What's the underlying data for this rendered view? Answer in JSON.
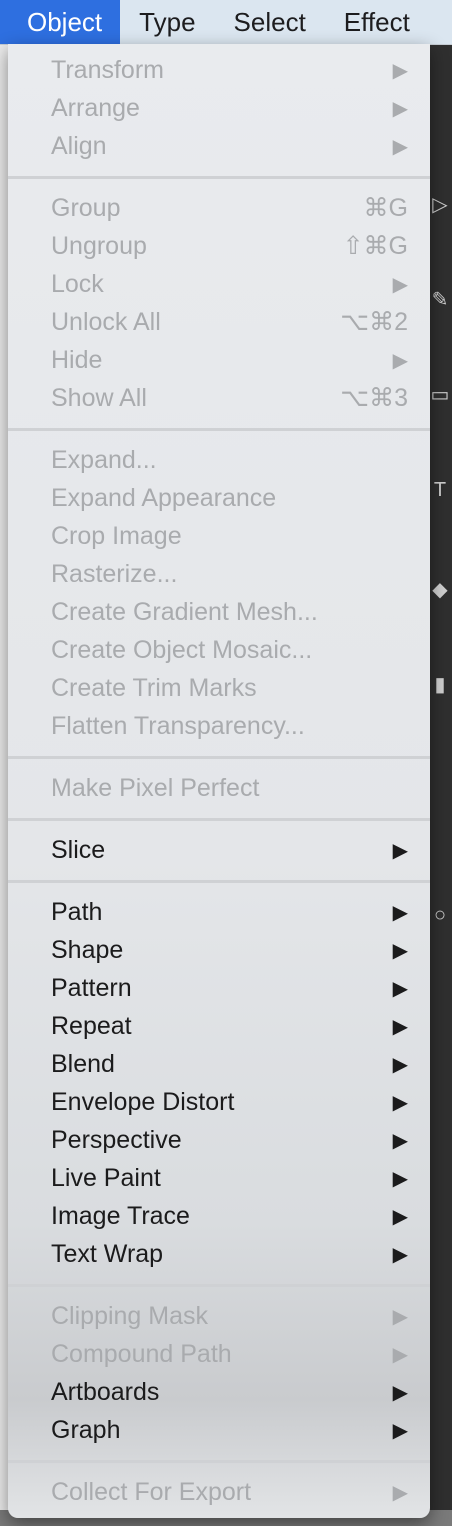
{
  "menubar": {
    "items": [
      "Object",
      "Type",
      "Select",
      "Effect"
    ]
  },
  "menu": {
    "groups": [
      [
        {
          "label": "Transform",
          "shortcut": "",
          "submenu": true,
          "enabled": false
        },
        {
          "label": "Arrange",
          "shortcut": "",
          "submenu": true,
          "enabled": false
        },
        {
          "label": "Align",
          "shortcut": "",
          "submenu": true,
          "enabled": false
        }
      ],
      [
        {
          "label": "Group",
          "shortcut": "⌘G",
          "submenu": false,
          "enabled": false
        },
        {
          "label": "Ungroup",
          "shortcut": "⇧⌘G",
          "submenu": false,
          "enabled": false
        },
        {
          "label": "Lock",
          "shortcut": "",
          "submenu": true,
          "enabled": false
        },
        {
          "label": "Unlock All",
          "shortcut": "⌥⌘2",
          "submenu": false,
          "enabled": false
        },
        {
          "label": "Hide",
          "shortcut": "",
          "submenu": true,
          "enabled": false
        },
        {
          "label": "Show All",
          "shortcut": "⌥⌘3",
          "submenu": false,
          "enabled": false
        }
      ],
      [
        {
          "label": "Expand...",
          "shortcut": "",
          "submenu": false,
          "enabled": false
        },
        {
          "label": "Expand Appearance",
          "shortcut": "",
          "submenu": false,
          "enabled": false
        },
        {
          "label": "Crop Image",
          "shortcut": "",
          "submenu": false,
          "enabled": false
        },
        {
          "label": "Rasterize...",
          "shortcut": "",
          "submenu": false,
          "enabled": false
        },
        {
          "label": "Create Gradient Mesh...",
          "shortcut": "",
          "submenu": false,
          "enabled": false
        },
        {
          "label": "Create Object Mosaic...",
          "shortcut": "",
          "submenu": false,
          "enabled": false
        },
        {
          "label": "Create Trim Marks",
          "shortcut": "",
          "submenu": false,
          "enabled": false
        },
        {
          "label": "Flatten Transparency...",
          "shortcut": "",
          "submenu": false,
          "enabled": false
        }
      ],
      [
        {
          "label": "Make Pixel Perfect",
          "shortcut": "",
          "submenu": false,
          "enabled": false
        }
      ],
      [
        {
          "label": "Slice",
          "shortcut": "",
          "submenu": true,
          "enabled": true
        }
      ],
      [
        {
          "label": "Path",
          "shortcut": "",
          "submenu": true,
          "enabled": true
        },
        {
          "label": "Shape",
          "shortcut": "",
          "submenu": true,
          "enabled": true
        },
        {
          "label": "Pattern",
          "shortcut": "",
          "submenu": true,
          "enabled": true
        },
        {
          "label": "Repeat",
          "shortcut": "",
          "submenu": true,
          "enabled": true
        },
        {
          "label": "Blend",
          "shortcut": "",
          "submenu": true,
          "enabled": true
        },
        {
          "label": "Envelope Distort",
          "shortcut": "",
          "submenu": true,
          "enabled": true
        },
        {
          "label": "Perspective",
          "shortcut": "",
          "submenu": true,
          "enabled": true
        },
        {
          "label": "Live Paint",
          "shortcut": "",
          "submenu": true,
          "enabled": true
        },
        {
          "label": "Image Trace",
          "shortcut": "",
          "submenu": true,
          "enabled": true
        },
        {
          "label": "Text Wrap",
          "shortcut": "",
          "submenu": true,
          "enabled": true
        }
      ],
      [
        {
          "label": "Clipping Mask",
          "shortcut": "",
          "submenu": true,
          "enabled": false
        },
        {
          "label": "Compound Path",
          "shortcut": "",
          "submenu": true,
          "enabled": false
        },
        {
          "label": "Artboards",
          "shortcut": "",
          "submenu": true,
          "enabled": true
        },
        {
          "label": "Graph",
          "shortcut": "",
          "submenu": true,
          "enabled": true
        }
      ],
      [
        {
          "label": "Collect For Export",
          "shortcut": "",
          "submenu": true,
          "enabled": false
        }
      ]
    ]
  }
}
